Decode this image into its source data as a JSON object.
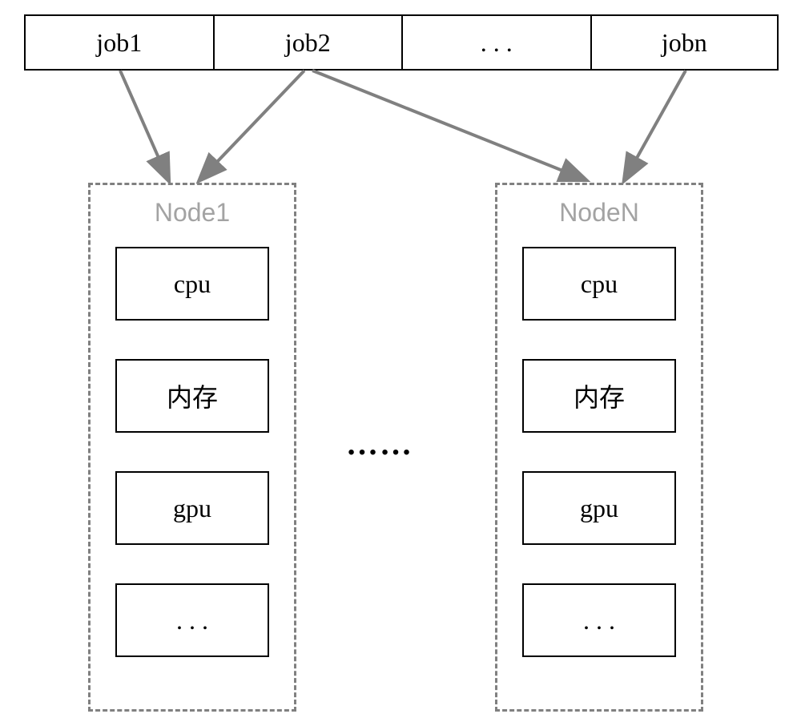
{
  "jobs": {
    "items": [
      "job1",
      "job2",
      ". . .",
      "jobn"
    ]
  },
  "nodes": {
    "left": {
      "title": "Node1",
      "resources": [
        "cpu",
        "内存",
        "gpu",
        ". . ."
      ]
    },
    "right": {
      "title": "NodeN",
      "resources": [
        "cpu",
        "内存",
        "gpu",
        ". . ."
      ]
    }
  },
  "between_ellipsis": "……",
  "arrow_color": "#808080"
}
